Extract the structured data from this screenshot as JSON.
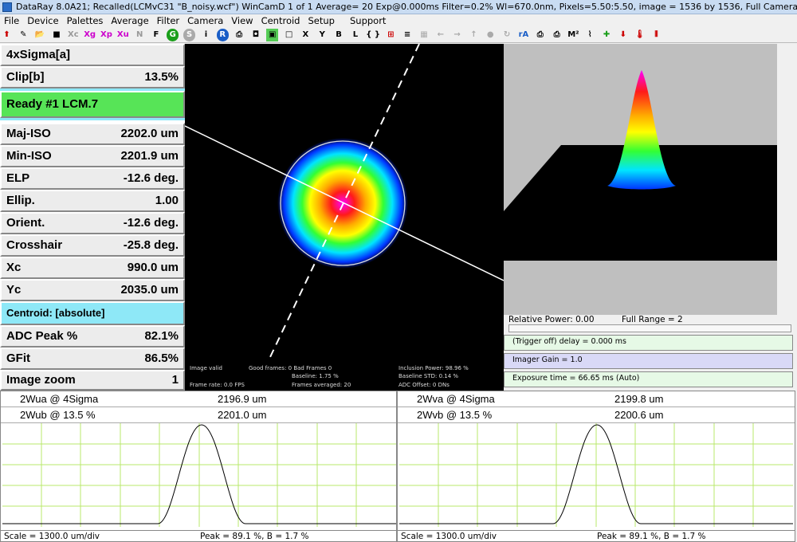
{
  "window": {
    "title": "DataRay 8.0A21; Recalled(LCMvC31 \"B_noisy.wcf\")   WinCamD 1 of 1   Average= 20   Exp@0.000ms  Filter=0.2%     Wl=670.0nm, Pixels=5.50:5.50, image = 1536 by 1536, Full    Camera #1"
  },
  "menu": [
    "File",
    "Device",
    "Palettes",
    "Average",
    "Filter",
    "Camera",
    "View",
    "Centroid",
    "Setup",
    "Support"
  ],
  "toolbar": [
    "Xc",
    "Xg",
    "Xp",
    "Xu",
    "N",
    "F",
    "X",
    "Y",
    "B",
    "L",
    "rA",
    "M²"
  ],
  "params": [
    {
      "label": "4xSigma[a]",
      "value": ""
    },
    {
      "label": "Clip[b]",
      "value": "13.5%"
    },
    {
      "label": "Ready    #1 LCM.7",
      "value": ""
    },
    {
      "label": "Maj-ISO",
      "value": "2202.0 um"
    },
    {
      "label": "Min-ISO",
      "value": "2201.9 um"
    },
    {
      "label": "ELP",
      "value": "-12.6 deg."
    },
    {
      "label": "Ellip.",
      "value": "1.00"
    },
    {
      "label": "Orient.",
      "value": "-12.6 deg."
    },
    {
      "label": "Crosshair",
      "value": "-25.8 deg."
    },
    {
      "label": "Xc",
      "value": "990.0 um"
    },
    {
      "label": "Yc",
      "value": "2035.0 um"
    },
    {
      "label": "Centroid: [absolute]",
      "value": ""
    },
    {
      "label": "ADC Peak %",
      "value": "82.1%"
    },
    {
      "label": "GFit",
      "value": "86.5%"
    },
    {
      "label": "Image zoom",
      "value": "1"
    }
  ],
  "image_info": {
    "valid": "Image valid",
    "frames": "Good frames: 0 Bad Frames 0",
    "baseline": "Baseline: 1.75 %",
    "inclusion": "Inclusion Power: 98.96 %",
    "baseline_std": "Baseline STD:  0.14 %",
    "frame_rate": "Frame rate: 0.0 FPS",
    "averaged": "Frames averaged: 20",
    "adc_offset": "ADC Offset: 0 DNs"
  },
  "readout": {
    "relative_power": "Relative Power: 0.00",
    "full_range": "Full Range = 2",
    "delay": "(Trigger off) delay = 0.000 ms",
    "gain": "Imager Gain = 1.0",
    "exposure": "Exposure time = 66.65 ms (Auto)"
  },
  "profiles": [
    {
      "row1_label": "2Wua @ 4Sigma",
      "row1_value": "2196.9 um",
      "row2_label": "2Wub @ 13.5 %",
      "row2_value": "2201.0 um",
      "scale": "Scale = 1300.0 um/div",
      "peak": "Peak = 89.1 %,  B = 1.7 %"
    },
    {
      "row1_label": "2Wva @ 4Sigma",
      "row1_value": "2199.8 um",
      "row2_label": "2Wvb @ 13.5 %",
      "row2_value": "2200.6 um",
      "scale": "Scale = 1300.0 um/div",
      "peak": "Peak = 89.1 %,  B = 1.7 %"
    }
  ],
  "colors": {
    "ready": "#57e457",
    "centroid": "#8ee8f7",
    "grid": "#b9e86b",
    "panel": "#ececec"
  }
}
